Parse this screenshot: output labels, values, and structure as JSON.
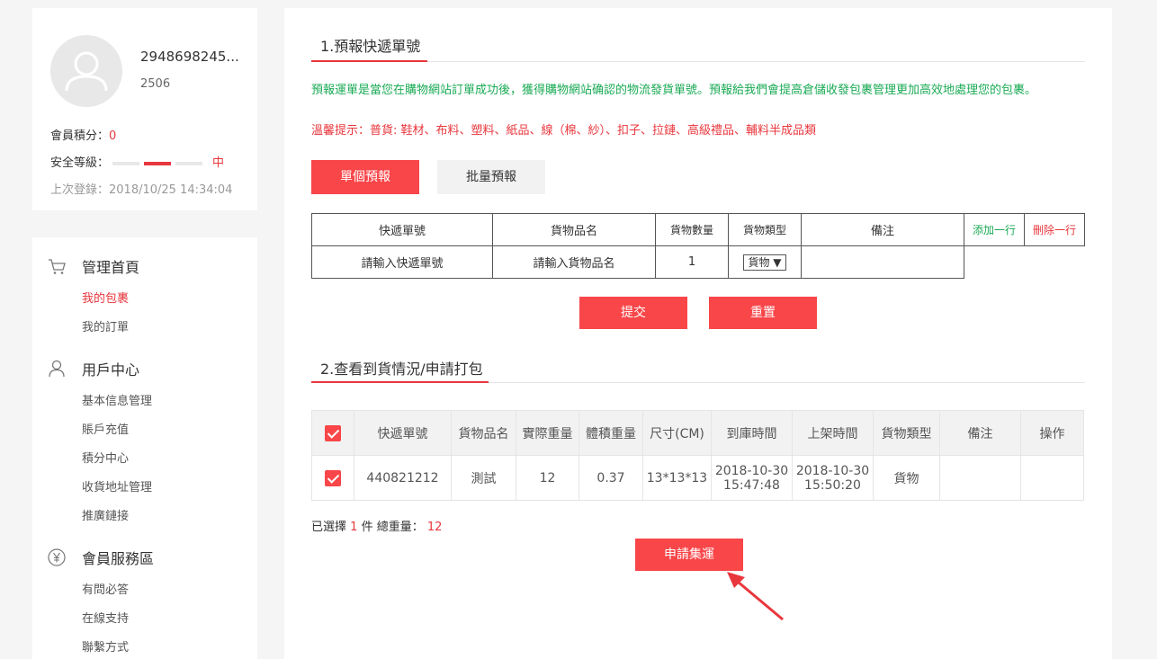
{
  "profile": {
    "username": "2948698245...",
    "user_id": "2506",
    "points_label": "會員積分：",
    "points_value": "0",
    "safety_label": "安全等級：",
    "safety_level": "中",
    "last_login": "上次登錄：2018/10/25 14:34:04"
  },
  "menu": {
    "sections": [
      {
        "title": "管理首頁",
        "icon": "cart-icon",
        "items": [
          "我的包裹",
          "我的訂單"
        ]
      },
      {
        "title": "用戶中心",
        "icon": "user-icon",
        "items": [
          "基本信息管理",
          "賬戶充值",
          "積分中心",
          "收貨地址管理",
          "推廣鏈接"
        ]
      },
      {
        "title": "會員服務區",
        "icon": "yen-icon",
        "items": [
          "有問必答",
          "在線支持",
          "聯繫方式"
        ]
      }
    ],
    "active_item": "我的包裹"
  },
  "section1": {
    "title": "1.預報快遞單號",
    "notice_green": "預報運單是當您在購物網站訂單成功後，獲得購物網站确認的物流發貨單號。預報給我們會提高倉儲收發包裹管理更加高效地處理您的包裹。",
    "notice_red": "溫馨提示：普貨: 鞋材、布料、塑料、紙品、線（棉、紗）、扣子、拉鏈、高級禮品、輔料半成品類",
    "tab_single": "單個預報",
    "tab_batch": "批量預報",
    "table": {
      "headers": [
        "快遞單號",
        "貨物品名",
        "貨物數量",
        "貨物類型",
        "備注"
      ],
      "add_row": "添加一行",
      "delete_row": "刪除一行",
      "tracking_placeholder": "請輸入快遞單號",
      "goods_placeholder": "請輸入貨物品名",
      "quantity": "1",
      "type_selected": "貨物",
      "remark": ""
    },
    "submit": "提交",
    "reset": "重置"
  },
  "section2": {
    "title": "2.查看到貨情況/申請打包",
    "table": {
      "headers": [
        "快遞單號",
        "貨物品名",
        "實際重量",
        "體積重量",
        "尺寸(CM)",
        "到庫時間",
        "上架時間",
        "貨物類型",
        "備注",
        "操作"
      ],
      "rows": [
        {
          "tracking": "440821212",
          "goods": "測試",
          "actual_weight": "12",
          "volume_weight": "0.37",
          "size": "13*13*13",
          "arrival_date": "2018-10-30",
          "arrival_time": "15:47:48",
          "shelf_date": "2018-10-30",
          "shelf_time": "15:50:20",
          "type": "貨物",
          "remark": "",
          "action": ""
        }
      ]
    },
    "summary_prefix": "已選擇",
    "selected_count": "1",
    "summary_mid": "件 總重量：",
    "total_weight": "12",
    "apply_button": "申請集運"
  },
  "colors": {
    "accent": "#f84649",
    "green": "#1aaa55",
    "red_text": "#e8373d"
  }
}
